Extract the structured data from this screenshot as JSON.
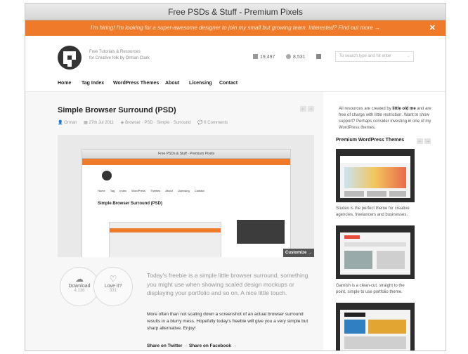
{
  "window": {
    "title": "Free PSDs & Stuff - Premium Pixels"
  },
  "promo": {
    "text": "I'm hiring! I'm looking for a super-awesome designer to join my small but growing team. Interested? Find out more →",
    "close": "✕"
  },
  "masthead": {
    "tagline_line1": "Free Tutorials & Resources",
    "tagline_line2": "for Creative folk by Orman Clark",
    "rss_count": "19,497",
    "twitter_count": "8,531",
    "search_placeholder": "To search type and hit enter",
    "search_arrow": "→"
  },
  "nav": {
    "items": [
      "Home",
      "Tag Index",
      "WordPress Themes",
      "About",
      "Licensing",
      "Contact"
    ]
  },
  "post": {
    "title": "Simple Browser Surround (PSD)",
    "prev": "←",
    "next": "→",
    "author": "Orman",
    "date": "27th Jul 2011",
    "tags": "Browser · PSD · Simple · Surround",
    "comments": "6 Comments",
    "customize_label": "Customize →",
    "preview": {
      "window_title": "Free PSDs & Stuff - Premium Pixels",
      "nav": "Home Tag Index WordPress Themes About Licensing Contact",
      "post_title": "Simple Browser Surround (PSD)"
    },
    "download": {
      "label": "Download",
      "count": "4,136"
    },
    "love": {
      "label": "Love it?",
      "count": "331"
    },
    "intro": "Today's freebie is a simple little browser surround, something you might use when showing scaled design mockups or displaying your portfolio and so on. A nice little touch.",
    "body": "More often than not scaling down a screenshot of an actual browser surround results in a blurry mess. Hopefully today's freebie will give you a very simple but sharp alternative. Enjoy!",
    "share_twitter": "Share on Twitter",
    "share_facebook": "Share on Facebook",
    "share_arrow": "→"
  },
  "sidebar": {
    "intro_a": "All resources are created by ",
    "intro_b": "little old me",
    "intro_c": " and are free of charge with little restriction. Want to show support? Perhaps consider investing in one of my WordPress themes.",
    "themes_heading": "Premium WordPress Themes",
    "themes": [
      {
        "caption": "Studeo is the perfect theme for creative agencies, freelancers and businesses."
      },
      {
        "caption": "Garnish is a clean-cut, straight to the point, simple to use portfolio theme."
      },
      {
        "caption": ""
      }
    ]
  },
  "colors": {
    "accent": "#ef7a2a",
    "text": "#222222",
    "muted": "#999999"
  }
}
